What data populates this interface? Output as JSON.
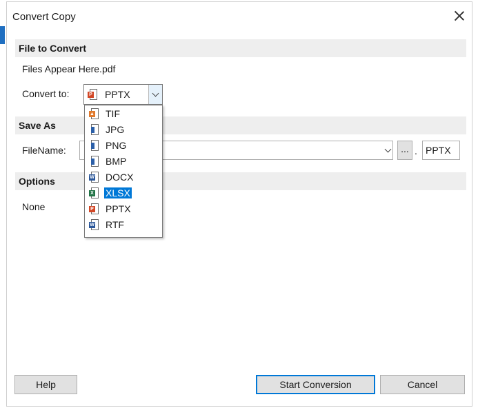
{
  "window": {
    "title": "Convert Copy"
  },
  "sections": {
    "file_to_convert": "File to Convert",
    "save_as": "Save As",
    "options": "Options"
  },
  "file": {
    "name": "Files Appear Here.pdf"
  },
  "convert_to": {
    "label": "Convert to:",
    "selected": "PPTX"
  },
  "format_options": [
    {
      "label": "TIF",
      "icon": "image-file-icon",
      "color": "#e07a2e"
    },
    {
      "label": "JPG",
      "icon": "image-file-icon",
      "color": "#2b5fa8"
    },
    {
      "label": "PNG",
      "icon": "image-file-icon",
      "color": "#2b5fa8"
    },
    {
      "label": "BMP",
      "icon": "image-file-icon",
      "color": "#2b5fa8"
    },
    {
      "label": "DOCX",
      "icon": "word-icon",
      "color": "#2b579a"
    },
    {
      "label": "XLSX",
      "icon": "excel-icon",
      "color": "#217346"
    },
    {
      "label": "PPTX",
      "icon": "powerpoint-icon",
      "color": "#d24726"
    },
    {
      "label": "RTF",
      "icon": "word-icon",
      "color": "#2b579a"
    }
  ],
  "highlighted_option": "XLSX",
  "save_as": {
    "filename_label": "FileName:",
    "filename_value": "",
    "browse_label": "...",
    "dot": ".",
    "extension": "PPTX"
  },
  "options": {
    "value": "None"
  },
  "buttons": {
    "help": "Help",
    "start": "Start Conversion",
    "cancel": "Cancel"
  },
  "colors": {
    "accent": "#0078d7",
    "section_bg": "#eeeeee",
    "button_bg": "#e1e1e1"
  }
}
